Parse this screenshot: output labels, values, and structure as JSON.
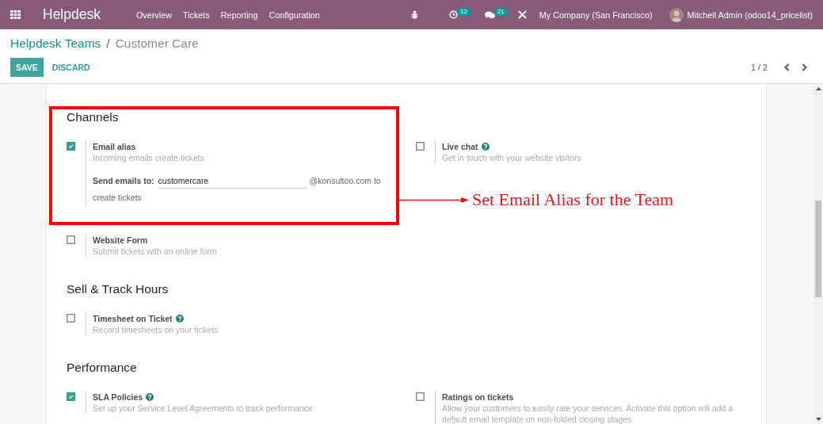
{
  "navbar": {
    "app_name": "Helpdesk",
    "menu": [
      "Overview",
      "Tickets",
      "Reporting",
      "Configuration"
    ],
    "activity_count": "12",
    "message_count": "21",
    "company": "My Company (San Francisco)",
    "user": "Mitchell Admin (odoo14_pricelist)"
  },
  "breadcrumb": {
    "items": [
      "Helpdesk Teams",
      "Customer Care"
    ],
    "separator": "/"
  },
  "buttons": [
    {
      "label": "SAVE",
      "kind": "primary"
    },
    {
      "label": "DISCARD",
      "kind": "link"
    }
  ],
  "pager": {
    "value": "1 / 2"
  },
  "sections": [
    {
      "title": "Channels",
      "settings": [
        {
          "title": "Email alias",
          "description": "Incoming emails create tickets",
          "checked": true,
          "help": false,
          "alias": {
            "label": "Send emails to:",
            "value": "customercare",
            "suffix_lines": [
              "@konsultoo.com to",
              "create tickets"
            ]
          }
        },
        {
          "title": "Live chat",
          "description": "Get in touch with your website visitors",
          "checked": false,
          "help": true
        },
        {
          "title": "Website Form",
          "description": "Submit tickets with an online form",
          "checked": false,
          "help": false
        }
      ]
    },
    {
      "title": "Sell & Track Hours",
      "settings": [
        {
          "title": "Timesheet on Ticket",
          "description": "Record timesheets on your tickets",
          "checked": false,
          "help": true
        }
      ]
    },
    {
      "title": "Performance",
      "settings": [
        {
          "title": "SLA Policies",
          "description": "Set up your Service Level Agreements to track performance",
          "checked": true,
          "help": true
        },
        {
          "title": "Ratings on tickets",
          "description": "Allow your customers to easily rate your services. Activate this option will add a default email template on non-folded closing stages",
          "checked": false,
          "help": false
        }
      ]
    }
  ],
  "annotation": {
    "text": "Set Email Alias for the Team"
  }
}
